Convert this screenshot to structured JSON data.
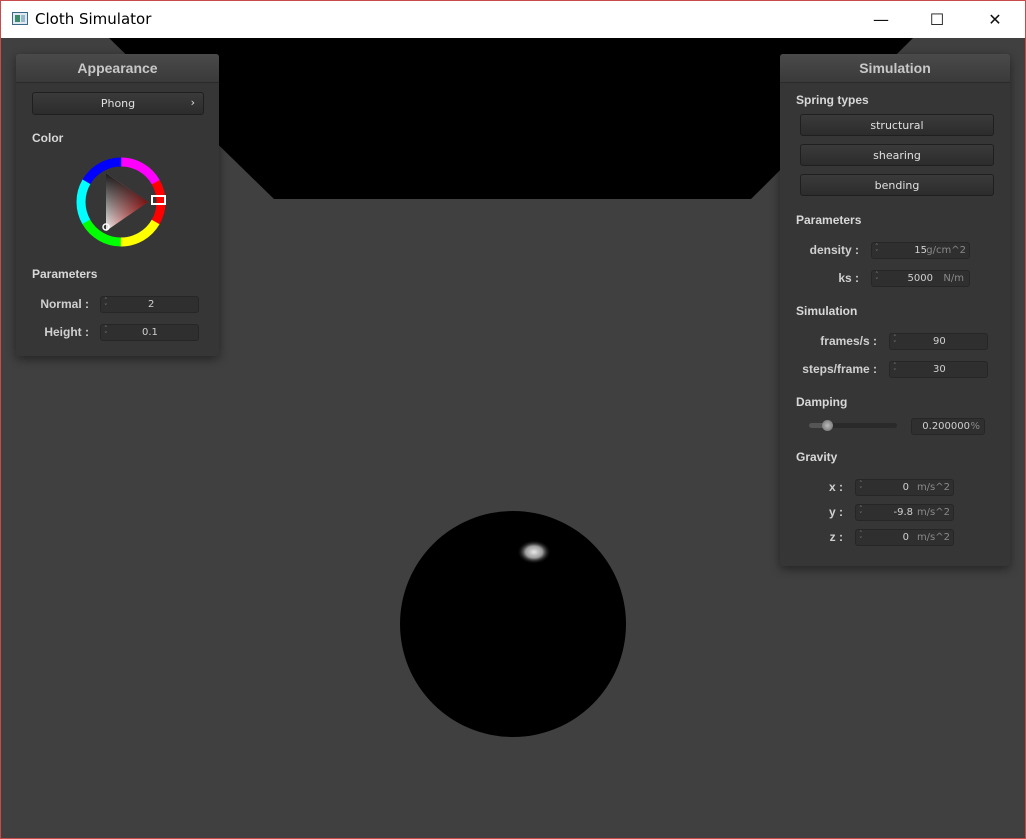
{
  "window": {
    "title": "Cloth Simulator",
    "minimize_glyph": "—",
    "maximize_glyph": "☐",
    "close_glyph": "✕"
  },
  "appearance": {
    "title": "Appearance",
    "shader": {
      "label": "Phong",
      "arrow": "›"
    },
    "color_label": "Color",
    "parameters_label": "Parameters",
    "normal": {
      "label": "Normal :",
      "value": "2"
    },
    "height": {
      "label": "Height :",
      "value": "0.1"
    }
  },
  "simulation": {
    "title": "Simulation",
    "spring_types_label": "Spring types",
    "springs": [
      "structural",
      "shearing",
      "bending"
    ],
    "parameters_label": "Parameters",
    "density": {
      "label": "density :",
      "value": "15",
      "unit": "g/cm^2"
    },
    "ks": {
      "label": "ks :",
      "value": "5000",
      "unit": "N/m"
    },
    "simulation_label": "Simulation",
    "fps": {
      "label": "frames/s :",
      "value": "90"
    },
    "steps": {
      "label": "steps/frame :",
      "value": "30"
    },
    "damping_label": "Damping",
    "damping": {
      "value": "0.200000",
      "unit": "%",
      "slider_level": 0.2
    },
    "gravity_label": "Gravity",
    "gravity": [
      {
        "label": "x :",
        "value": "0",
        "unit": "m/s^2"
      },
      {
        "label": "y :",
        "value": "-9.8",
        "unit": "m/s^2"
      },
      {
        "label": "z :",
        "value": "0",
        "unit": "m/s^2"
      }
    ]
  },
  "colors": {
    "background": "#404040",
    "selected_color": "#e02020"
  },
  "icons": [
    "app-icon",
    "spinner-icon",
    "chevron-right-icon",
    "color-wheel"
  ]
}
